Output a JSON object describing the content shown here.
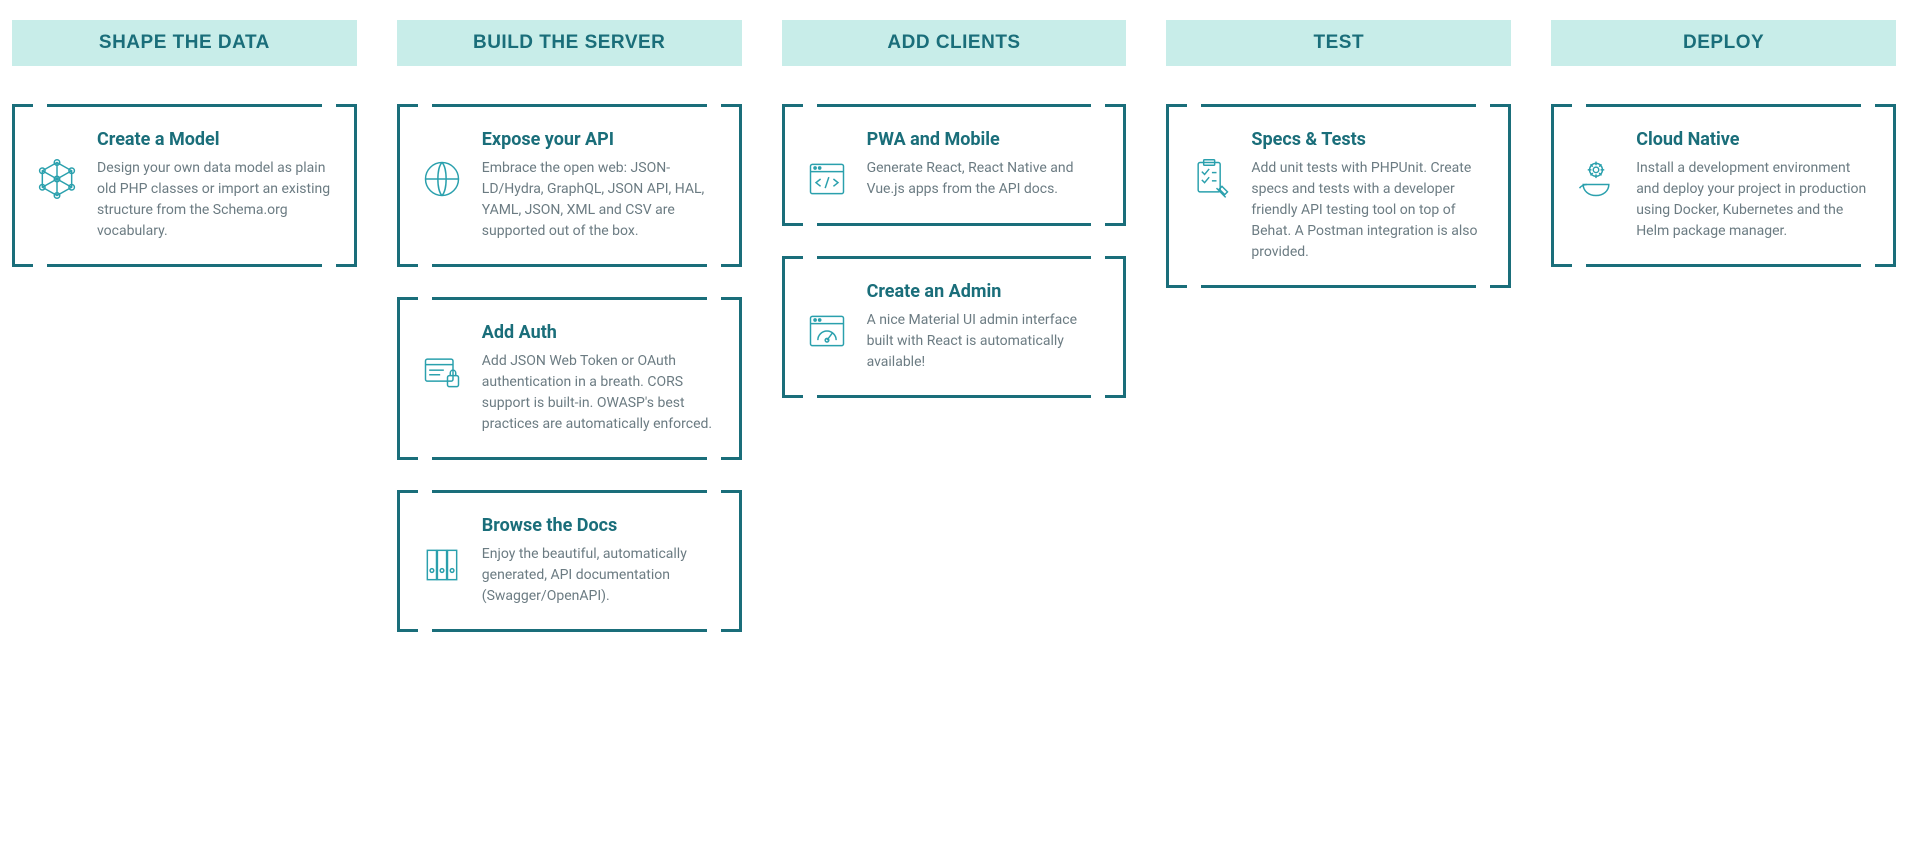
{
  "columns": [
    {
      "header": "SHAPE THE DATA",
      "cards": [
        {
          "icon": "model-graph-icon",
          "title": "Create a Model",
          "desc": "Design your own data model as plain old PHP classes or import an existing structure from the Schema.org vocabulary."
        }
      ]
    },
    {
      "header": "BUILD THE SERVER",
      "cards": [
        {
          "icon": "globe-api-icon",
          "title": "Expose your API",
          "desc": "Embrace the open web: JSON-LD/Hydra, GraphQL, JSON API, HAL, YAML, JSON, XML and CSV are supported out of the box."
        },
        {
          "icon": "auth-lock-icon",
          "title": "Add Auth",
          "desc": "Add JSON Web Token or OAuth authentication in a breath. CORS support is built-in. OWASP's best practices are automatically enforced."
        },
        {
          "icon": "docs-binder-icon",
          "title": "Browse the Docs",
          "desc": "Enjoy the beautiful, automatically generated, API documentation (Swagger/OpenAPI)."
        }
      ]
    },
    {
      "header": "ADD CLIENTS",
      "cards": [
        {
          "icon": "code-window-icon",
          "title": "PWA and Mobile",
          "desc": "Generate React, React Native and Vue.js apps from the API docs."
        },
        {
          "icon": "admin-dashboard-icon",
          "title": "Create an Admin",
          "desc": "A nice Material UI admin interface built with React is automatically available!"
        }
      ]
    },
    {
      "header": "TEST",
      "cards": [
        {
          "icon": "checklist-icon",
          "title": "Specs & Tests",
          "desc": "Add unit tests with PHPUnit. Create specs and tests with a developer friendly API testing tool on top of Behat. A Postman integration is also provided."
        }
      ]
    },
    {
      "header": "DEPLOY",
      "cards": [
        {
          "icon": "cloud-native-icon",
          "title": "Cloud Native",
          "desc": "Install a development environment and deploy your project in production using Docker, Kubernetes and the Helm package manager."
        }
      ]
    }
  ]
}
